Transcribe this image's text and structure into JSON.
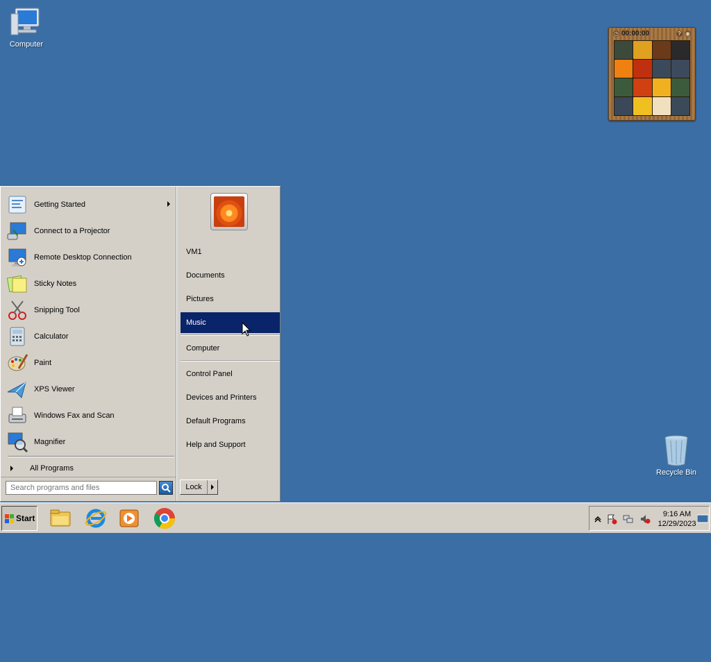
{
  "desktop": {
    "icons": [
      {
        "label": "Computer"
      },
      {
        "label": "Recycle Bin"
      }
    ],
    "background_color": "#3a6ea5"
  },
  "puzzle_gadget": {
    "timer": "00:00:00",
    "help_icon": "?",
    "tiles": [
      "#3c4a3c",
      "#e0a020",
      "#6a3a1a",
      "#2a2a2a",
      "#f08010",
      "#c03010",
      "#3a4a5a",
      "#3c4a5c",
      "#3c5a3c",
      "#d04010",
      "#f0b020",
      "#3c5a3c",
      "#3a4858",
      "#f0c020",
      "#f0e0c0",
      "#3a4a58"
    ]
  },
  "start_menu": {
    "programs": [
      {
        "label": "Getting Started",
        "icon": "getting-started-icon",
        "has_submenu": true
      },
      {
        "label": "Connect to a Projector",
        "icon": "projector-icon",
        "has_submenu": false
      },
      {
        "label": "Remote Desktop Connection",
        "icon": "remote-desktop-icon",
        "has_submenu": false
      },
      {
        "label": "Sticky Notes",
        "icon": "sticky-notes-icon",
        "has_submenu": false
      },
      {
        "label": "Snipping Tool",
        "icon": "scissors-icon",
        "has_submenu": false
      },
      {
        "label": "Calculator",
        "icon": "calculator-icon",
        "has_submenu": false
      },
      {
        "label": "Paint",
        "icon": "paint-palette-icon",
        "has_submenu": false
      },
      {
        "label": "XPS Viewer",
        "icon": "xps-viewer-icon",
        "has_submenu": false
      },
      {
        "label": "Windows Fax and Scan",
        "icon": "fax-icon",
        "has_submenu": false
      },
      {
        "label": "Magnifier",
        "icon": "magnifier-icon",
        "has_submenu": false
      }
    ],
    "all_programs_label": "All Programs",
    "search_placeholder": "Search programs and files",
    "places": [
      {
        "label": "VM1",
        "selected": false
      },
      {
        "label": "Documents",
        "selected": false
      },
      {
        "label": "Pictures",
        "selected": false
      },
      {
        "label": "Music",
        "selected": true
      },
      {
        "label": "Computer",
        "selected": false
      },
      {
        "label": "Control Panel",
        "selected": false
      },
      {
        "label": "Devices and Printers",
        "selected": false
      },
      {
        "label": "Default Programs",
        "selected": false
      },
      {
        "label": "Help and Support",
        "selected": false
      }
    ],
    "lock_label": "Lock",
    "selection_color": "#0a246a"
  },
  "taskbar": {
    "start_label": "Start",
    "pinned": [
      {
        "icon": "file-explorer-icon"
      },
      {
        "icon": "internet-explorer-icon"
      },
      {
        "icon": "media-player-icon"
      },
      {
        "icon": "chrome-icon"
      }
    ],
    "clock_time": "9:16 AM",
    "clock_date": "12/29/2023"
  }
}
